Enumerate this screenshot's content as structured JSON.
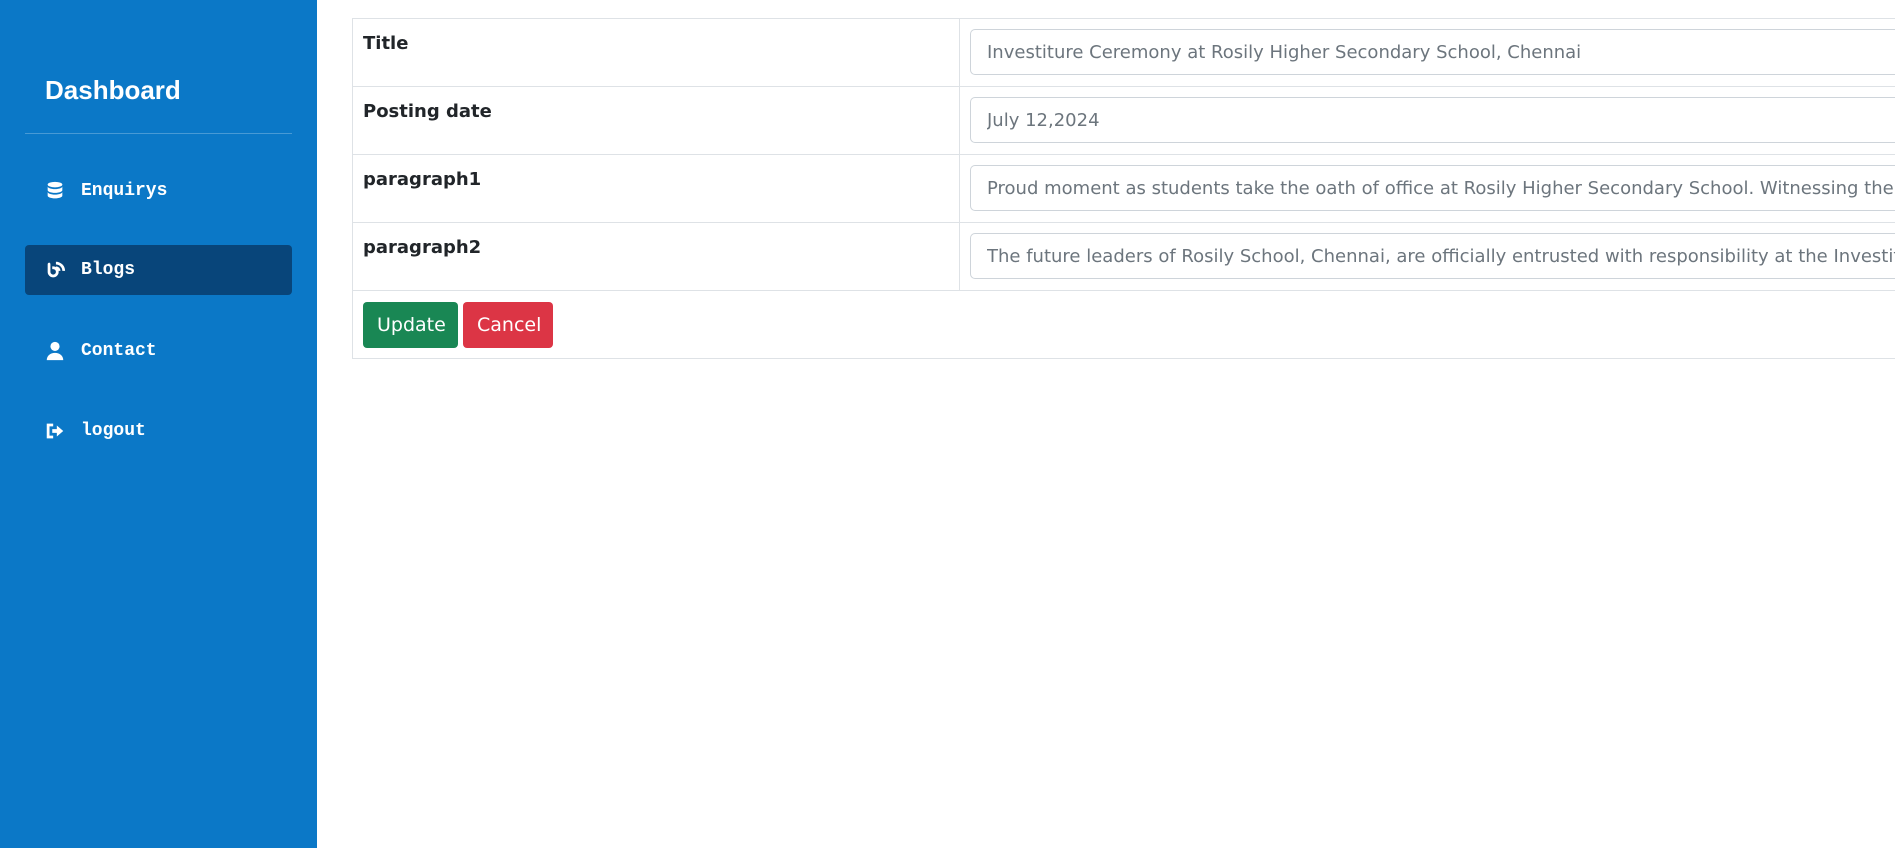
{
  "sidebar": {
    "brand": "Dashboard",
    "items": [
      {
        "label": "Enquirys",
        "icon": "database-icon"
      },
      {
        "label": "Blogs",
        "icon": "blog-icon"
      },
      {
        "label": "Contact",
        "icon": "user-icon"
      },
      {
        "label": "logout",
        "icon": "sign-out-icon"
      }
    ],
    "active_index": 1
  },
  "form": {
    "rows": [
      {
        "label": "Title",
        "value": "Investiture Ceremony at Rosily Higher Secondary School, Chennai"
      },
      {
        "label": "Posting date",
        "value": "July 12,2024"
      },
      {
        "label": "paragraph1",
        "value": "Proud moment as students take the oath of office at Rosily Higher Secondary School. Witnessing the investiture"
      },
      {
        "label": "paragraph2",
        "value": "The future leaders of Rosily School, Chennai, are officially entrusted with responsibility at the Investiture Ceremony"
      }
    ],
    "update_label": "Update",
    "cancel_label": "Cancel"
  },
  "colors": {
    "sidebar_bg": "#0b78c7",
    "sidebar_active": "#08457a",
    "update_btn": "#198754",
    "cancel_btn": "#dc3545"
  }
}
